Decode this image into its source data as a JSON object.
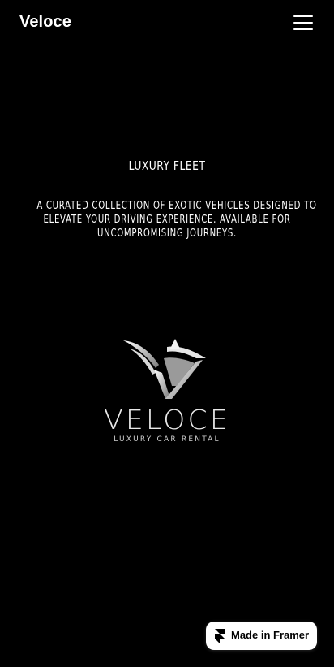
{
  "header": {
    "brand": "Veloce",
    "menu_icon": "hamburger-menu-icon"
  },
  "hero": {
    "title": "LUXURY FLEET",
    "description_lines": [
      "A CURATED COLLECTION OF EXOTIC VEHICLES DESIGNED TO",
      "ELEVATE YOUR DRIVING EXPERIENCE. AVAILABLE FOR",
      "UNCOMPROMISING JOURNEYS."
    ]
  },
  "logo": {
    "wordmark": "VELOCE",
    "tagline": "LUXURY CAR RENTAL",
    "mark_icon": "winged-v-logo-icon"
  },
  "badge": {
    "label": "Made in Framer",
    "icon": "framer-logo-icon"
  },
  "colors": {
    "background": "#000000",
    "text": "#ffffff",
    "badge_bg": "#ffffff"
  }
}
